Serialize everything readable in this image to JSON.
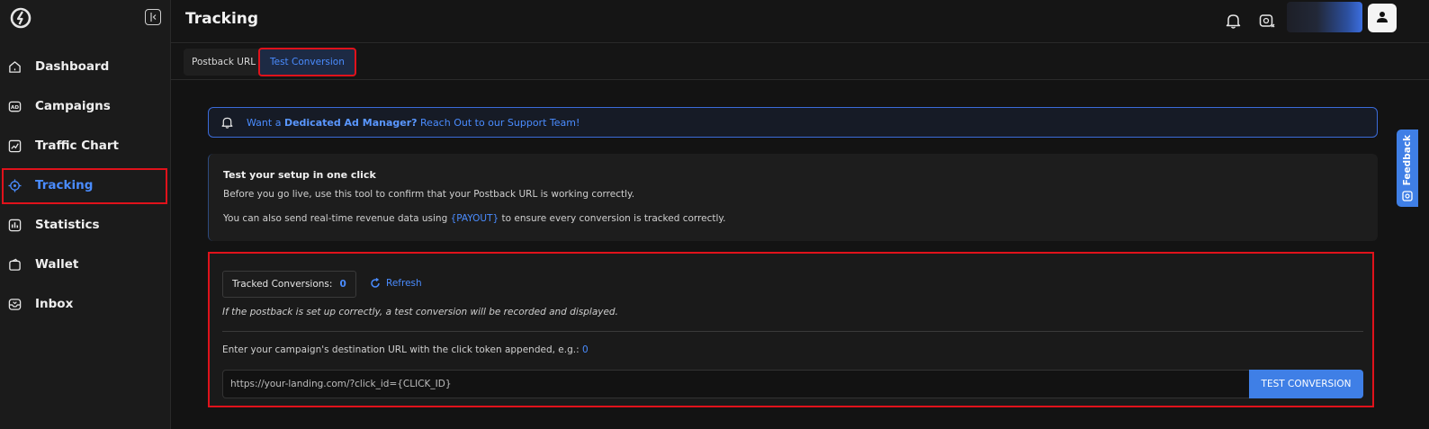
{
  "sidebar": {
    "items": [
      {
        "label": "Dashboard",
        "icon": "home-icon"
      },
      {
        "label": "Campaigns",
        "icon": "ad-icon"
      },
      {
        "label": "Traffic Chart",
        "icon": "chart-icon"
      },
      {
        "label": "Tracking",
        "icon": "target-icon",
        "active": true
      },
      {
        "label": "Statistics",
        "icon": "stats-icon"
      },
      {
        "label": "Wallet",
        "icon": "wallet-icon"
      },
      {
        "label": "Inbox",
        "icon": "inbox-icon"
      }
    ]
  },
  "header": {
    "title": "Tracking"
  },
  "tabs": [
    {
      "label": "Postback URL"
    },
    {
      "label": "Test Conversion",
      "active": true
    }
  ],
  "banner": {
    "prefix": "Want a ",
    "bold": "Dedicated Ad Manager?",
    "suffix": " Reach Out to our Support Team!"
  },
  "info": {
    "title": "Test your setup in one click",
    "line1": "Before you go live, use this tool to confirm that your Postback URL is working correctly.",
    "line2_prefix": "You can also send real-time revenue data using ",
    "line2_token": "{PAYOUT}",
    "line2_suffix": " to ensure every conversion is tracked correctly."
  },
  "test": {
    "tracked_label": "Tracked Conversions:",
    "tracked_count": "0",
    "refresh_label": "Refresh",
    "hint": "If the postback is set up correctly, a test conversion will be recorded and displayed.",
    "dest_label": "Enter your campaign's destination URL with the click token appended, e.g.: ",
    "dest_example": "0",
    "url_placeholder": "https://your-landing.com/?click_id={CLICK_ID}",
    "button_label": "TEST CONVERSION"
  },
  "feedback_label": "Feedback",
  "colors": {
    "accent": "#3f7fe6",
    "highlight": "#e0121b",
    "background": "#131313"
  }
}
